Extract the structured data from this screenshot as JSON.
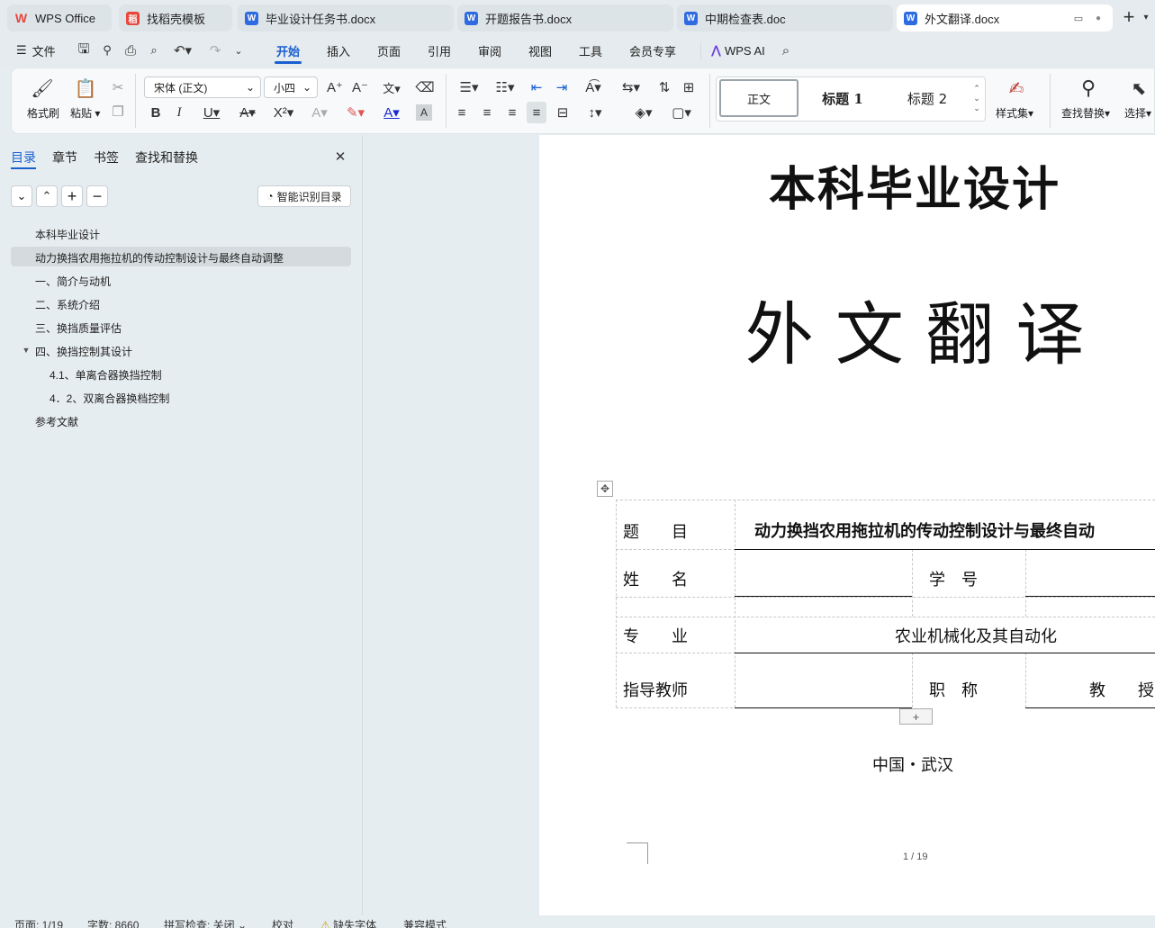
{
  "tabs": [
    {
      "label": "WPS Office",
      "icon": "wps-logo-icon",
      "color": "#e8453c"
    },
    {
      "label": "找稻壳模板",
      "icon": "docer-icon",
      "color": "#e8453c"
    },
    {
      "label": "毕业设计任务书.docx",
      "icon": "word-doc-icon",
      "color": "#2f6be0"
    },
    {
      "label": "开题报告书.docx",
      "icon": "word-doc-icon",
      "color": "#2f6be0"
    },
    {
      "label": "中期检查表.doc",
      "icon": "word-doc-icon",
      "color": "#2f6be0"
    },
    {
      "label": "外文翻译.docx",
      "icon": "word-doc-icon",
      "color": "#2f6be0"
    }
  ],
  "menu": {
    "file": "文件",
    "items": [
      "开始",
      "插入",
      "页面",
      "引用",
      "审阅",
      "视图",
      "工具",
      "会员专享"
    ],
    "active": "开始",
    "ai": "WPS AI"
  },
  "ribbon": {
    "format_painter": "格式刷",
    "paste": "粘贴",
    "font_name": "宋体 (正文)",
    "font_size": "小四",
    "styles": [
      "正文",
      "标题 1",
      "标题 2"
    ],
    "style_set": "样式集",
    "find_replace": "查找替换",
    "select": "选择",
    "accent": "#1a5fd0"
  },
  "panel": {
    "tabs": [
      "目录",
      "章节",
      "书签",
      "查找和替换"
    ],
    "active_tab": "目录",
    "smart_toc": "智能识别目录",
    "toc": [
      {
        "label": "本科毕业设计",
        "level": 1
      },
      {
        "label": "动力换挡农用拖拉机的传动控制设计与最终自动调整",
        "level": 1,
        "selected": true
      },
      {
        "label": "一、简介与动机",
        "level": 1
      },
      {
        "label": "二、系统介绍",
        "level": 1
      },
      {
        "label": "三、换挡质量评估",
        "level": 1
      },
      {
        "label": "四、换挡控制其设计",
        "level": 1,
        "expanded": true
      },
      {
        "label": "4.1、单离合器换挡控制",
        "level": 2
      },
      {
        "label": "4．2、双离合器换档控制",
        "level": 2
      },
      {
        "label": "参考文献",
        "level": 1
      }
    ]
  },
  "document": {
    "title": "本科毕业设计",
    "subtitle": "外 文 翻 译",
    "table": {
      "topic_label": "题　　目",
      "topic_value": "动力换挡农用拖拉机的传动控制设计与最终自动",
      "name_label": "姓　　名",
      "student_id_label": "学　号",
      "major_label": "专　　业",
      "major_value": "农业机械化及其自动化",
      "advisor_label": "指导教师",
      "title_label": "职　称",
      "title_value": "教　　授"
    },
    "location": "中国・武汉",
    "page_indicator": "1 / 19"
  },
  "status": {
    "page": "页面: 1/19",
    "words": "字数: 8660",
    "spell": "拼写检查: 关闭",
    "proof": "校对",
    "missing_font": "缺失字体",
    "compat": "兼容模式"
  }
}
